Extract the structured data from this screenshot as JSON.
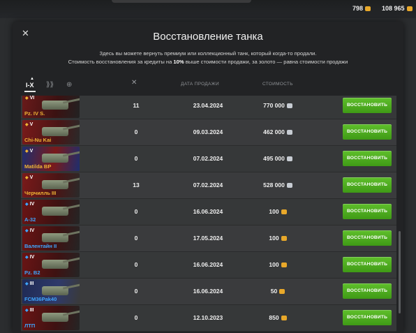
{
  "currency": {
    "gold": "798",
    "silver": "108 965"
  },
  "dialog": {
    "title": "Восстановление танка",
    "desc_line1": "Здесь вы можете вернуть премиум или коллекционный танк, который когда-то продали.",
    "desc_line2_a": "Стоимость восстановления за кредиты на ",
    "desc_line2_b": "10%",
    "desc_line2_c": " выше стоимости продажи, за золото — равна стоимости продажи",
    "tier_filter": "I-X"
  },
  "columns": {
    "date": "ДАТА ПРОДАЖИ",
    "cost": "СТОИМОСТЬ"
  },
  "restore_label": "ВОССТАНОВИТЬ",
  "colors": {
    "accent_green": "#4fae1f",
    "gold": "#e8a82a",
    "silver": "#c7ccd3",
    "premium_name": "#f0b535",
    "collector_name": "#3fa6ff"
  },
  "rows": [
    {
      "tier": "VI",
      "name": "Pz. IV S.",
      "type": "premium",
      "battles": "11",
      "date": "23.04.2024",
      "cost": "770 000",
      "currency": "silver"
    },
    {
      "tier": "V",
      "name": "Chi-Nu Kai",
      "type": "premium",
      "battles": "0",
      "date": "09.03.2024",
      "cost": "462 000",
      "currency": "silver"
    },
    {
      "tier": "V",
      "name": "Matilda BP",
      "type": "premium",
      "battles": "0",
      "date": "07.02.2024",
      "cost": "495 000",
      "currency": "silver"
    },
    {
      "tier": "V",
      "name": "Черчилль III",
      "type": "premium",
      "battles": "13",
      "date": "07.02.2024",
      "cost": "528 000",
      "currency": "silver"
    },
    {
      "tier": "IV",
      "name": "A-32",
      "type": "collector",
      "battles": "0",
      "date": "16.06.2024",
      "cost": "100",
      "currency": "gold"
    },
    {
      "tier": "IV",
      "name": "Валентайн II",
      "type": "collector",
      "battles": "0",
      "date": "17.05.2024",
      "cost": "100",
      "currency": "gold"
    },
    {
      "tier": "IV",
      "name": "Pz. B2",
      "type": "collector",
      "battles": "0",
      "date": "16.06.2024",
      "cost": "100",
      "currency": "gold"
    },
    {
      "tier": "III",
      "name": "FCM36Pak40",
      "type": "collector",
      "battles": "0",
      "date": "16.06.2024",
      "cost": "50",
      "currency": "gold"
    },
    {
      "tier": "III",
      "name": "ЛТП",
      "type": "collector",
      "battles": "0",
      "date": "12.10.2023",
      "cost": "850",
      "currency": "gold"
    }
  ]
}
